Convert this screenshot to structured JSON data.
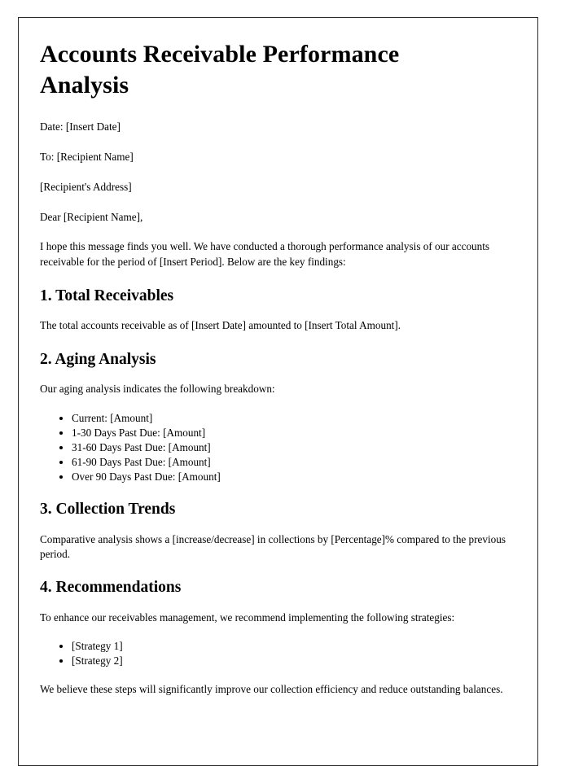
{
  "document": {
    "title": "Accounts Receivable Performance Analysis",
    "meta": {
      "date_line": "Date: [Insert Date]",
      "to_line": "To: [Recipient Name]",
      "address_line": "[Recipient's Address]"
    },
    "salutation": "Dear [Recipient Name],",
    "intro_paragraph": "I hope this message finds you well. We have conducted a thorough performance analysis of our accounts receivable for the period of [Insert Period]. Below are the key findings:",
    "sections": [
      {
        "heading": "1. Total Receivables",
        "paragraph": "The total accounts receivable as of [Insert Date] amounted to [Insert Total Amount]."
      },
      {
        "heading": "2. Aging Analysis",
        "paragraph": "Our aging analysis indicates the following breakdown:",
        "bullets": [
          "Current: [Amount]",
          "1-30 Days Past Due: [Amount]",
          "31-60 Days Past Due: [Amount]",
          "61-90 Days Past Due: [Amount]",
          "Over 90 Days Past Due: [Amount]"
        ]
      },
      {
        "heading": "3. Collection Trends",
        "paragraph": "Comparative analysis shows a [increase/decrease] in collections by [Percentage]% compared to the previous period."
      },
      {
        "heading": "4. Recommendations",
        "paragraph": "To enhance our receivables management, we recommend implementing the following strategies:",
        "bullets": [
          "[Strategy 1]",
          "[Strategy 2]"
        ]
      }
    ],
    "closing_paragraph": "We believe these steps will significantly improve our collection efficiency and reduce outstanding balances."
  }
}
